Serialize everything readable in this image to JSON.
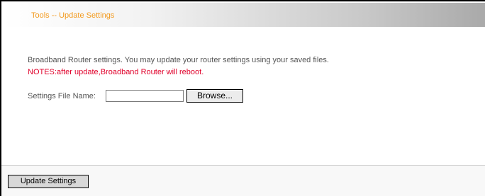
{
  "header": {
    "title": "Tools -- Update Settings"
  },
  "main": {
    "description": "Broadband Router settings. You may update your router settings using your saved files.",
    "notes": "NOTES:after update,Broadband Router will reboot.",
    "file_label": "Settings File Name:",
    "file_value": "",
    "browse_label": "Browse..."
  },
  "footer": {
    "update_label": "Update Settings"
  },
  "colors": {
    "title": "#f39a1e",
    "notes": "#e0002a",
    "text": "#555555"
  }
}
